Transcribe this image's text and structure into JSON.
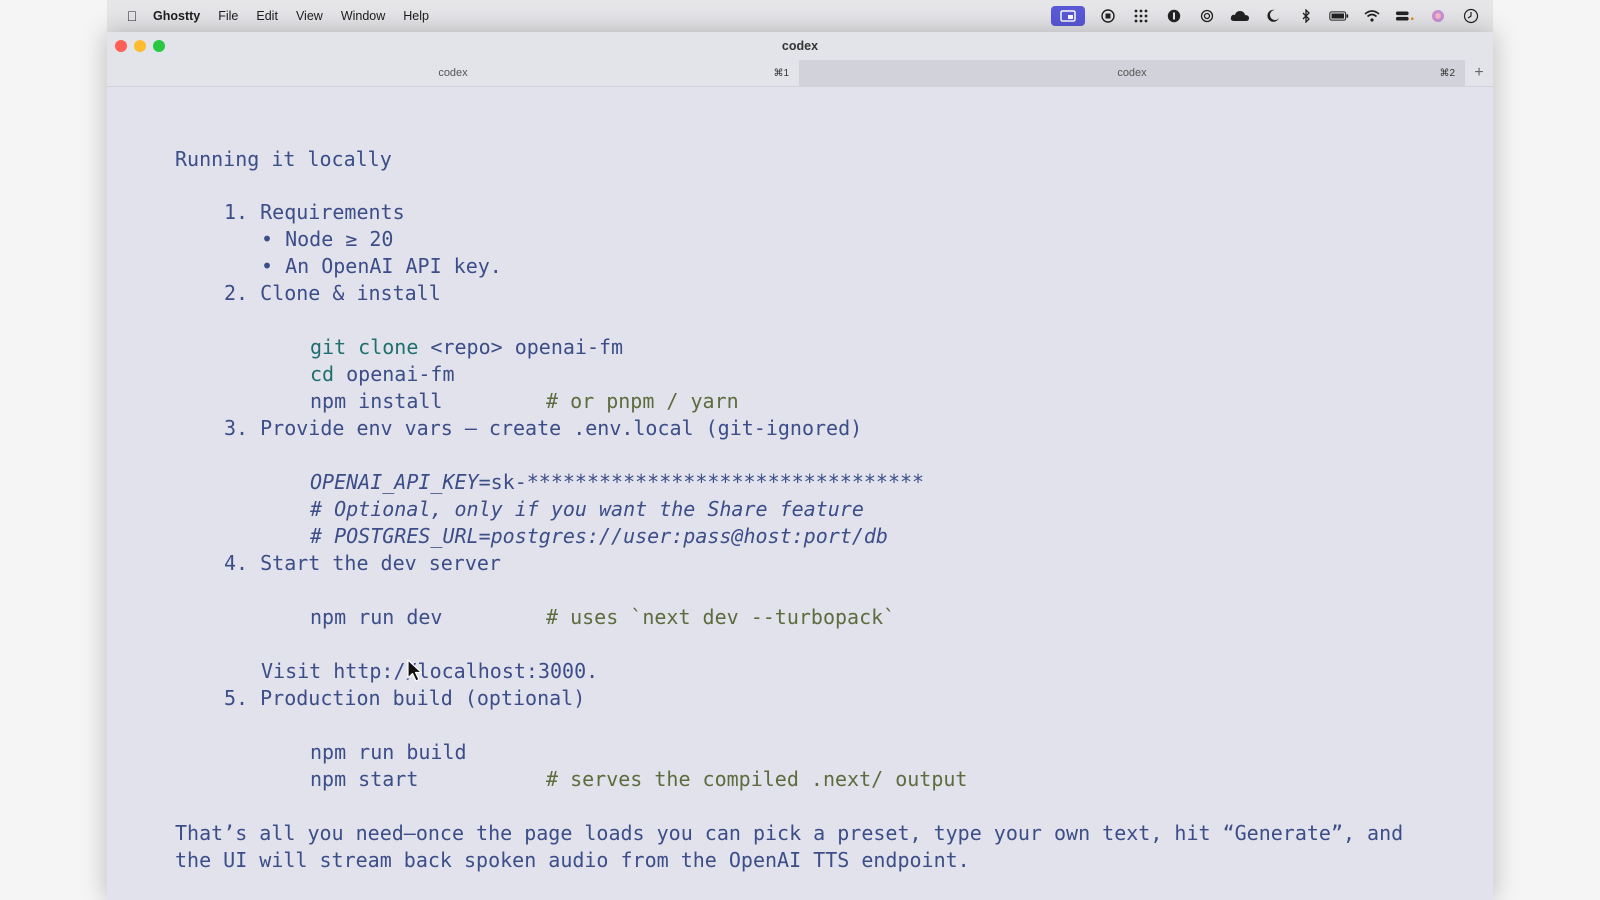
{
  "menubar": {
    "app_name": "Ghostty",
    "menus": [
      "File",
      "Edit",
      "View",
      "Window",
      "Help"
    ],
    "status_icons": [
      "screen-share-icon",
      "record-icon",
      "grid-icon",
      "onepassword-icon",
      "openai-icon",
      "cloud-icon",
      "moon-icon",
      "bluetooth-icon",
      "battery-icon",
      "wifi-icon",
      "control-center-icon",
      "siri-icon",
      "clock-icon"
    ]
  },
  "window": {
    "title": "codex",
    "tabs": [
      {
        "label": "codex",
        "shortcut": "⌘1"
      },
      {
        "label": "codex",
        "shortcut": "⌘2"
      }
    ],
    "new_tab_label": "+"
  },
  "terminal": {
    "heading": "Running it locally",
    "step1": "1. Requirements",
    "step1_b1": "• Node ≥ 20",
    "step1_b2": "• An OpenAI API key.",
    "step2": "2. Clone & install",
    "s2_l1_kw": "git clone",
    "s2_l1_rest": " <repo> openai-fm",
    "s2_l2_kw": "cd",
    "s2_l2_rest": " openai-fm",
    "s2_l3": "npm install",
    "s2_l3_comment": "# or pnpm / yarn",
    "step3": "3. Provide env vars – create .env.local (git-ignored)",
    "s3_l1_key": "OPENAI_API_KEY",
    "s3_l1_val": "=sk-*********************************",
    "s3_l2": "# Optional, only if you want the Share feature",
    "s3_l3": "# POSTGRES_URL=postgres://user:pass@host:port/db",
    "step4": "4. Start the dev server",
    "s4_l1": "npm run dev",
    "s4_l1_comment": "# uses `next dev --turbopack`",
    "s4_visit": "Visit http://localhost:3000.",
    "step5": "5. Production build (optional)",
    "s5_l1": "npm run build",
    "s5_l2": "npm start",
    "s5_l2_comment": "# serves the compiled .next/ output",
    "closing_1": "That’s all you need—once the page loads you can pick a preset, type your own text, hit “Generate”, and",
    "closing_2": "the UI will stream back spoken audio from the OpenAI TTS endpoint."
  }
}
